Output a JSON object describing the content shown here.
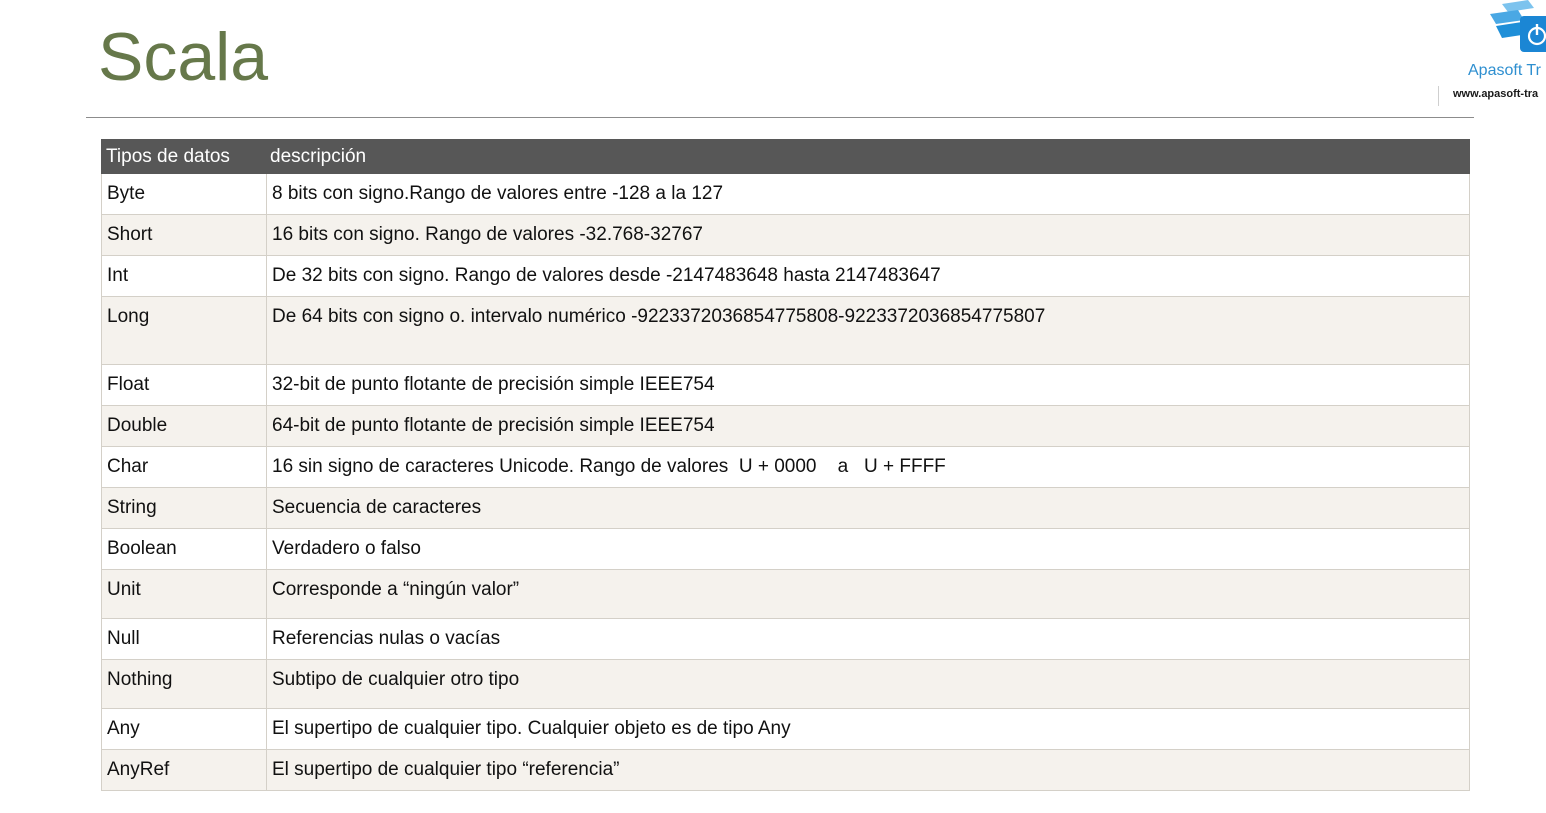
{
  "slide": {
    "title": "Scala"
  },
  "logo": {
    "name": "Apasoft Tr",
    "url": "www.apasoft-tra",
    "icon": "power-icon",
    "brand_color": "#2e8fd0"
  },
  "table": {
    "headers": [
      "Tipos de datos",
      "descripción"
    ],
    "header_color": "#575757",
    "rows": [
      {
        "type": "Byte",
        "description": "8 bits con signo.Rango de valores entre -128 a la 127"
      },
      {
        "type": "Short",
        "description": "16 bits con signo. Rango de valores -32.768-32767"
      },
      {
        "type": "Int",
        "description": "De 32 bits con signo. Rango de valores desde -2147483648 hasta 2147483647"
      },
      {
        "type": "Long",
        "description": "De 64 bits con signo o. intervalo numérico -9223372036854775808-9223372036854775807"
      },
      {
        "type": "Float",
        "description": "32-bit de punto flotante de precisión simple IEEE754"
      },
      {
        "type": "Double",
        "description": "64-bit de punto flotante de precisión simple IEEE754"
      },
      {
        "type": "Char",
        "description": "16 sin signo de caracteres Unicode. Rango de valores  U + 0000    a   U + FFFF"
      },
      {
        "type": "String",
        "description": "Secuencia de caracteres"
      },
      {
        "type": "Boolean",
        "description": "Verdadero o falso"
      },
      {
        "type": "Unit",
        "description": "Corresponde a “ningún valor”"
      },
      {
        "type": "Null",
        "description": "Referencias nulas o vacías"
      },
      {
        "type": "Nothing",
        "description": "Subtipo de cualquier otro tipo"
      },
      {
        "type": "Any",
        "description": "El supertipo de cualquier tipo. Cualquier objeto es de tipo Any"
      },
      {
        "type": "AnyRef",
        "description": "El supertipo de cualquier tipo “referencia”"
      }
    ]
  }
}
